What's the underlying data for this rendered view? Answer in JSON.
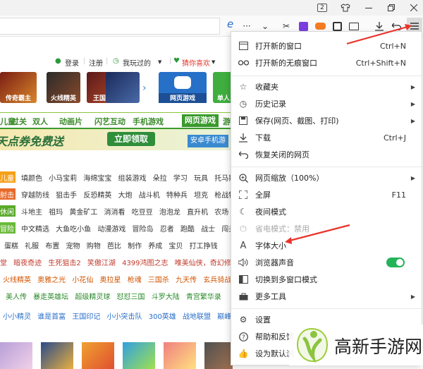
{
  "titlebar": {
    "tab_count": "2"
  },
  "toolbar": {
    "compat_icon": "e",
    "more": "···",
    "dropdown": "⌄"
  },
  "topnav": {
    "login": "登录",
    "register": "注册",
    "recent": "我玩过的",
    "recommend": "猜你喜欢"
  },
  "banner": {
    "games": [
      "传奇霸主",
      "火线精英",
      "王国纪元",
      "",
      "网页游戏",
      "单人"
    ]
  },
  "categories": [
    "儿童",
    "过关",
    "双人",
    "动画片",
    "闪艺互动",
    "手机游戏",
    "网页游戏",
    "游"
  ],
  "promo": {
    "text": "天点券免费送",
    "button": "立即领取",
    "side": "安卓手机游"
  },
  "rows": [
    {
      "tag": "儿童",
      "items": "填颜色 小马宝莉 海绵宝宝 组装游戏 朵拉 学习 玩具 托马斯"
    },
    {
      "tag": "射击",
      "items": "穿越防线 狙击手 反恐精英 大炮 战斗机 特种兵 坦克 枪战特警"
    },
    {
      "tag": "休闲",
      "items": "斗地主 祖玛 黄金矿工 消消看 吃豆豆 泡泡龙 直升机 农场"
    },
    {
      "tag": "冒险",
      "items": "中文精选 大鱼吃小鱼 动漫游戏 冒险岛 忍者 跑酷 战士 闯关"
    },
    {
      "tag": "",
      "items": "蛋糕 礼服 布置 宠物 购物 芭比 制作 养成 宝贝 打工挣钱"
    },
    {
      "tag": "",
      "items": "堂 暗夜奇迹 生死狙击2 笑傲江湖 4399鸿图之志 唯美仙侠，奇幻修仙"
    },
    {
      "tag": "",
      "items": "火线精英 奥雅之光 小花仙 奥拉星 枪魂 三国杀 九天传 玄兵骑战"
    },
    {
      "tag": "",
      "items": "美人传 暴走英雄坛 超级精灵球 怼怼三国 斗罗大陆 青宫繁华录"
    },
    {
      "tag": "",
      "items": "小小精灵 谁是首富 王国印记 小小突击队 300英雄 战地联盟 巅峰冠军"
    }
  ],
  "menu": {
    "items": [
      {
        "label": "打开新的窗口",
        "shortcut": "Ctrl+N",
        "icon": "new-window-icon"
      },
      {
        "label": "打开新的无痕窗口",
        "shortcut": "Ctrl+Shift+N",
        "icon": "incognito-icon"
      },
      {
        "label": "收藏夹",
        "icon": "star-icon"
      },
      {
        "label": "历史记录",
        "icon": "history-icon"
      },
      {
        "label": "保存(网页、截图、打印)",
        "icon": "save-icon"
      },
      {
        "label": "下载",
        "shortcut": "Ctrl+J",
        "icon": "download-icon"
      },
      {
        "label": "恢复关闭的网页",
        "icon": "restore-icon"
      },
      {
        "label": "网页缩放（100%）",
        "icon": "zoom-icon"
      },
      {
        "label": "全屏",
        "shortcut": "F11",
        "icon": "fullscreen-icon"
      },
      {
        "label": "夜间模式",
        "icon": "moon-icon"
      },
      {
        "label": "省电模式：禁用",
        "icon": "power-save-icon"
      },
      {
        "label": "字体大小",
        "icon": "font-size-icon"
      },
      {
        "label": "浏览器声音",
        "icon": "sound-icon"
      },
      {
        "label": "切换到多窗口模式",
        "icon": "multi-window-icon"
      },
      {
        "label": "更多工具",
        "icon": "toolbox-icon"
      },
      {
        "label": "设置",
        "icon": "settings-icon"
      },
      {
        "label": "帮助和反馈",
        "icon": "help-icon"
      },
      {
        "label": "设为默认浏",
        "icon": "default-browser-icon"
      }
    ]
  },
  "watermark": {
    "text": "高新手游网"
  },
  "colors": {
    "accent_green": "#25b35a",
    "arrow_red": "#e8352b",
    "nav_green": "#3a9a2c"
  }
}
